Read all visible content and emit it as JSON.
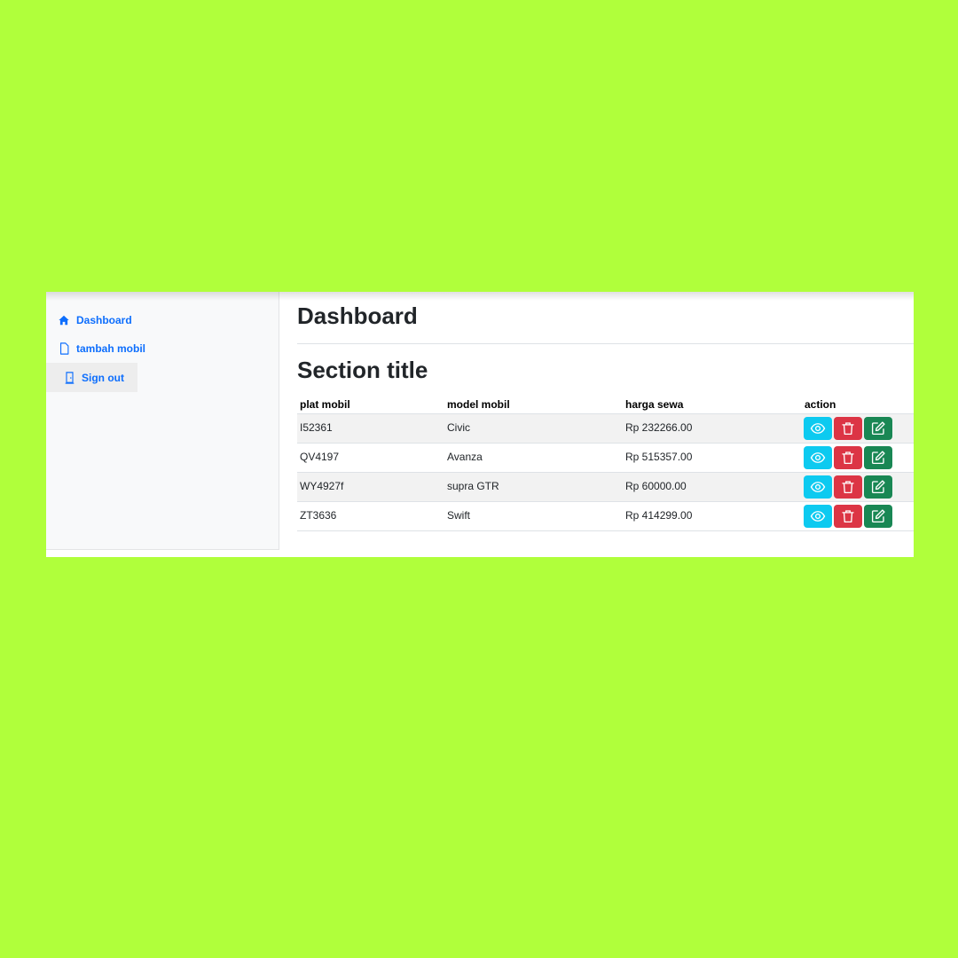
{
  "sidebar": {
    "items": [
      {
        "label": "Dashboard",
        "icon": "home-icon"
      },
      {
        "label": "tambah mobil",
        "icon": "file-icon"
      },
      {
        "label": "Sign out",
        "icon": "door-icon"
      }
    ]
  },
  "main": {
    "title": "Dashboard",
    "section_title": "Section title",
    "table": {
      "headers": [
        "plat mobil",
        "model mobil",
        "harga sewa",
        "action"
      ],
      "rows": [
        {
          "plat": "I52361",
          "model": "Civic",
          "harga": "Rp 232266.00"
        },
        {
          "plat": "QV4197",
          "model": "Avanza",
          "harga": "Rp 515357.00"
        },
        {
          "plat": "WY4927f",
          "model": "supra GTR",
          "harga": "Rp 60000.00"
        },
        {
          "plat": "ZT3636",
          "model": "Swift",
          "harga": "Rp 414299.00"
        }
      ]
    }
  },
  "colors": {
    "background": "#b0ff3b",
    "link": "#0d6efd",
    "view_button": "#0dcaf0",
    "delete_button": "#dc3545",
    "edit_button": "#198754"
  }
}
